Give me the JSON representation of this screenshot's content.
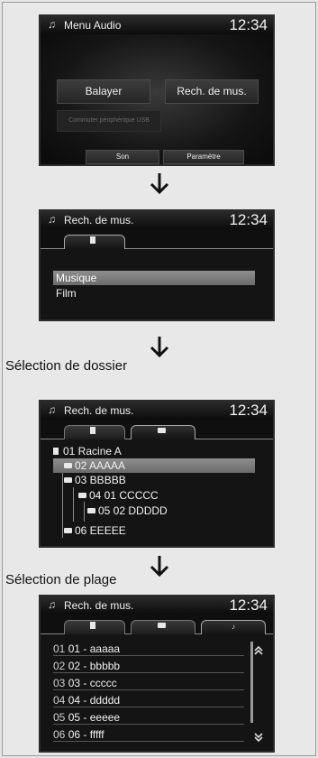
{
  "screens": {
    "audio_menu": {
      "title": "Menu Audio",
      "clock": "12:34",
      "buttons": {
        "balayer": "Balayer",
        "rech_de_mus": "Rech. de mus.",
        "usb": "Commuter périphérique USB",
        "son": "Son",
        "parametre": "Paramètre"
      }
    },
    "music_search": {
      "title": "Rech. de mus.",
      "clock": "12:34",
      "items": [
        "Musique",
        "Film"
      ]
    },
    "folder_select": {
      "label": "Sélection de dossier",
      "title": "Rech. de mus.",
      "clock": "12:34",
      "items": [
        "01 Racine A",
        "02 AAAAA",
        "03 BBBBB",
        "04 01 CCCCC",
        "05 02 DDDDD",
        "06 EEEEE"
      ]
    },
    "track_select": {
      "label": "Sélection de plage",
      "title": "Rech. de mus.",
      "clock": "12:34",
      "tracks": [
        {
          "num": "01",
          "sub": "01",
          "name": "aaaaa"
        },
        {
          "num": "02",
          "sub": "02",
          "name": "bbbbb"
        },
        {
          "num": "03",
          "sub": "03",
          "name": "ccccc"
        },
        {
          "num": "04",
          "sub": "04",
          "name": "ddddd"
        },
        {
          "num": "05",
          "sub": "05",
          "name": "eeeee"
        },
        {
          "num": "06",
          "sub": "06",
          "name": "fffff"
        }
      ]
    }
  },
  "icons": {
    "note": "music-note-icon",
    "disc": "disc-icon",
    "folder": "folder-icon",
    "arrow": "arrow-down-icon"
  },
  "colors": {
    "screen_bg": "#141414",
    "selected_row": "#7d7d7d",
    "page_bg": "#e6e6e6"
  }
}
